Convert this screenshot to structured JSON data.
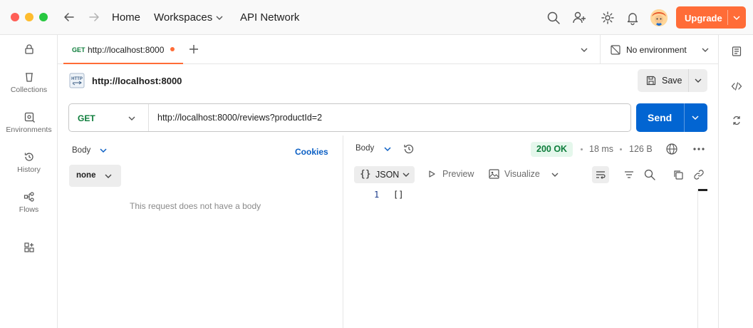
{
  "titlebar": {
    "nav_home": "Home",
    "nav_workspaces": "Workspaces",
    "nav_api_network": "API Network",
    "upgrade_label": "Upgrade",
    "colors": {
      "close": "#ff5f57",
      "minimize": "#febc2e",
      "maximize": "#28c840",
      "upgrade": "#ff6c37"
    }
  },
  "sidebar": {
    "items": [
      {
        "label": "",
        "icon": "lock-icon"
      },
      {
        "label": "Collections",
        "icon": "collections-icon"
      },
      {
        "label": "Environments",
        "icon": "environments-icon"
      },
      {
        "label": "History",
        "icon": "history-icon"
      },
      {
        "label": "Flows",
        "icon": "flows-icon"
      },
      {
        "label": "",
        "icon": "add-apps-icon"
      }
    ]
  },
  "tabs": {
    "active": {
      "method": "GET",
      "title": "http://localhost:8000",
      "unsaved": true
    },
    "environment": "No environment"
  },
  "request": {
    "title": "http://localhost:8000",
    "save_label": "Save",
    "method": "GET",
    "url": "http://localhost:8000/reviews?productId=2",
    "send_label": "Send",
    "body_tab": "Body",
    "cookies_label": "Cookies",
    "body_type": "none",
    "empty_body_text": "This request does not have a body"
  },
  "response": {
    "body_tab": "Body",
    "status": "200 OK",
    "time": "18 ms",
    "size": "126 B",
    "format": "JSON",
    "preview_label": "Preview",
    "visualize_label": "Visualize",
    "lines": [
      {
        "number": "1",
        "text": "[]"
      }
    ]
  }
}
